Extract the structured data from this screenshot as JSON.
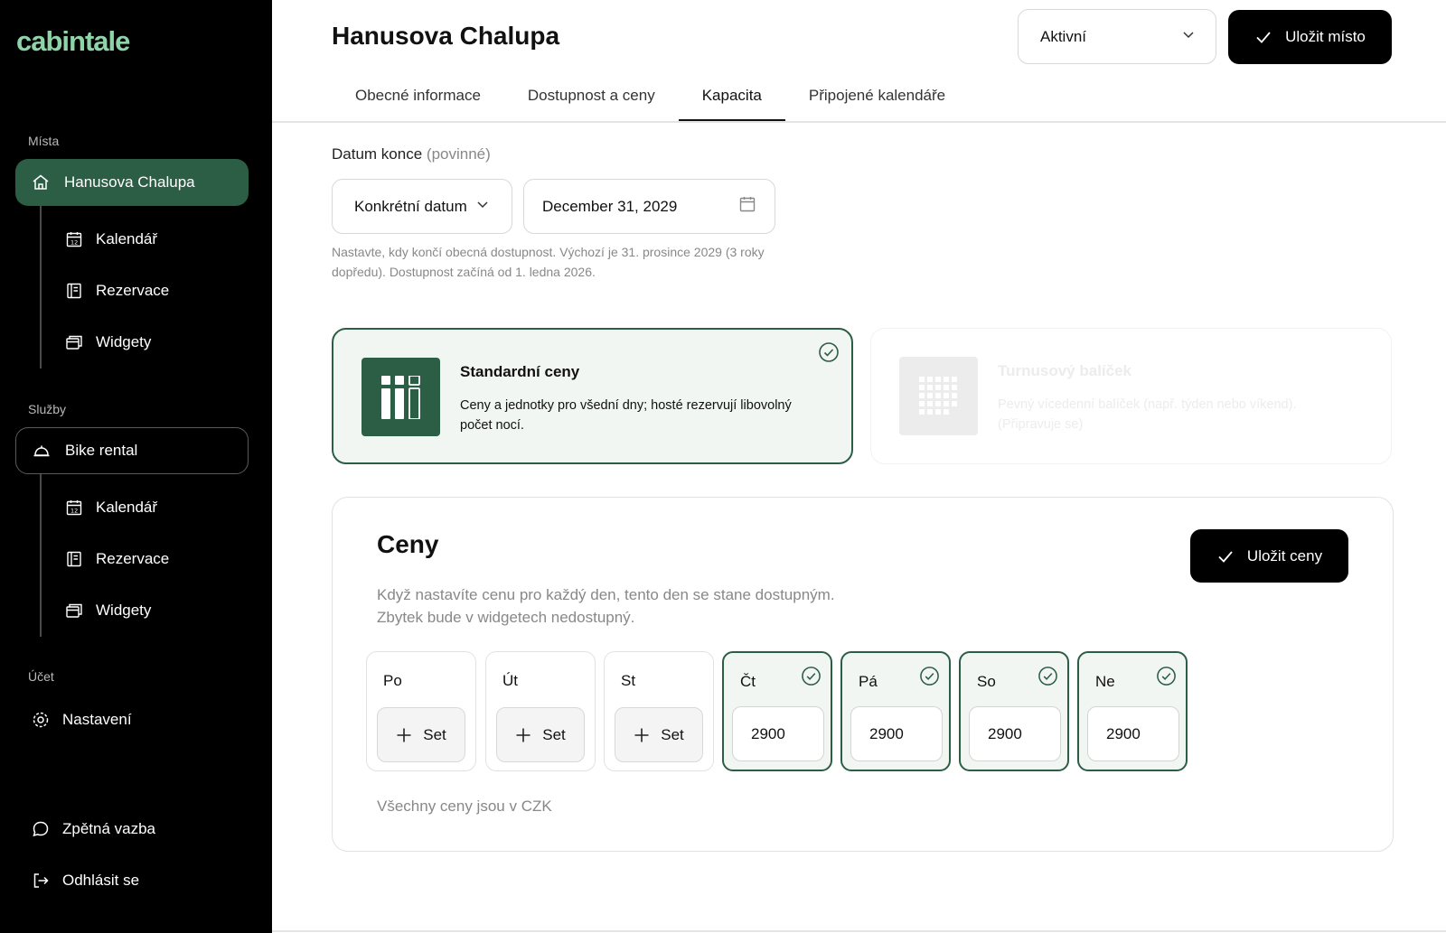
{
  "app": {
    "logo": "cabintale"
  },
  "sidebar": {
    "places_label": "Místa",
    "place": {
      "name": "Hanusova Chalupa",
      "sub_items": [
        "Kalendář",
        "Rezervace",
        "Widgety"
      ]
    },
    "services_label": "Služby",
    "service": {
      "name": "Bike rental",
      "sub_items": [
        "Kalendář",
        "Rezervace",
        "Widgety"
      ]
    },
    "account_label": "Účet",
    "settings_label": "Nastavení",
    "feedback_label": "Zpětná vazba",
    "logout_label": "Odhlásit se"
  },
  "header": {
    "title": "Hanusova Chalupa",
    "status_value": "Aktivní",
    "save_place_label": "Uložit místo",
    "tabs": [
      "Obecné informace",
      "Dostupnost a ceny",
      "Kapacita",
      "Připojené kalendáře"
    ],
    "active_tab": "Kapacita"
  },
  "end_date": {
    "label": "Datum konce",
    "label_note": "(povinné)",
    "type_value": "Konkrétní datum",
    "date_value": "December 31, 2029",
    "hint": "Nastavte, kdy končí obecná dostupnost. Výchozí je 31. prosince 2029 (3 roky dopředu). Dostupnost začíná od 1. ledna 2026."
  },
  "pricing_types": [
    {
      "title": "Standardní ceny",
      "description": "Ceny a jednotky pro všední dny; hosté rezervují libovolný počet nocí.",
      "selected": true
    },
    {
      "title": "Turnusový balíček",
      "description": "Pevný vícedenní balíček (např. týden nebo víkend). (Připravuje se)",
      "selected": false
    }
  ],
  "prices": {
    "title": "Ceny",
    "save_label": "Uložit ceny",
    "subtitle": "Když nastavíte cenu pro každý den, tento den se stane dostupným. Zbytek bude v widgetech nedostupný.",
    "set_label": "Set",
    "days": [
      {
        "name": "Po",
        "price": null
      },
      {
        "name": "Út",
        "price": null
      },
      {
        "name": "St",
        "price": null
      },
      {
        "name": "Čt",
        "price": "2900"
      },
      {
        "name": "Pá",
        "price": "2900"
      },
      {
        "name": "So",
        "price": "2900"
      },
      {
        "name": "Ne",
        "price": "2900"
      }
    ],
    "footer": "Všechny ceny jsou v CZK"
  },
  "colors": {
    "brand_green": "#2c5d45",
    "logo_green": "#8fd3a8",
    "sidebar_bg": "#000000"
  }
}
